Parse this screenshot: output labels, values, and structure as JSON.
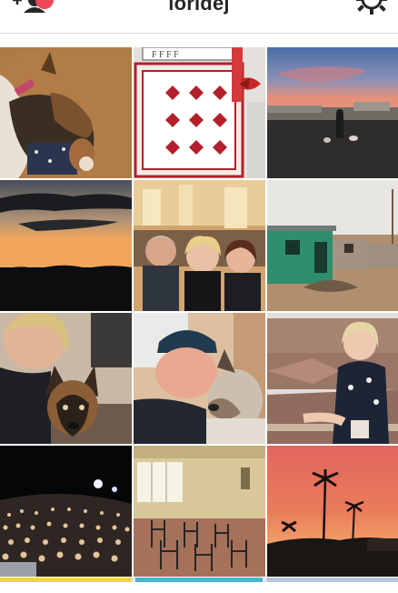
{
  "header": {
    "username": "loridej",
    "add_people_icon": "add-person-icon",
    "notification_badge_color": "#ed4956",
    "settings_icon": "gear-icon"
  },
  "grid": {
    "columns": 3,
    "photos": [
      {
        "subject": "german-shepherd-sleeping"
      },
      {
        "subject": "red-white-quilt"
      },
      {
        "subject": "dusk-courtyard"
      },
      {
        "subject": "sunset-clouds"
      },
      {
        "subject": "group-selfie-church"
      },
      {
        "subject": "green-building-yard"
      },
      {
        "subject": "selfie-with-puppy"
      },
      {
        "subject": "selfie-dog-kiss"
      },
      {
        "subject": "woman-on-balcony"
      },
      {
        "subject": "concert-crowd"
      },
      {
        "subject": "classroom-chairs"
      },
      {
        "subject": "palm-tree-sunset"
      }
    ]
  }
}
